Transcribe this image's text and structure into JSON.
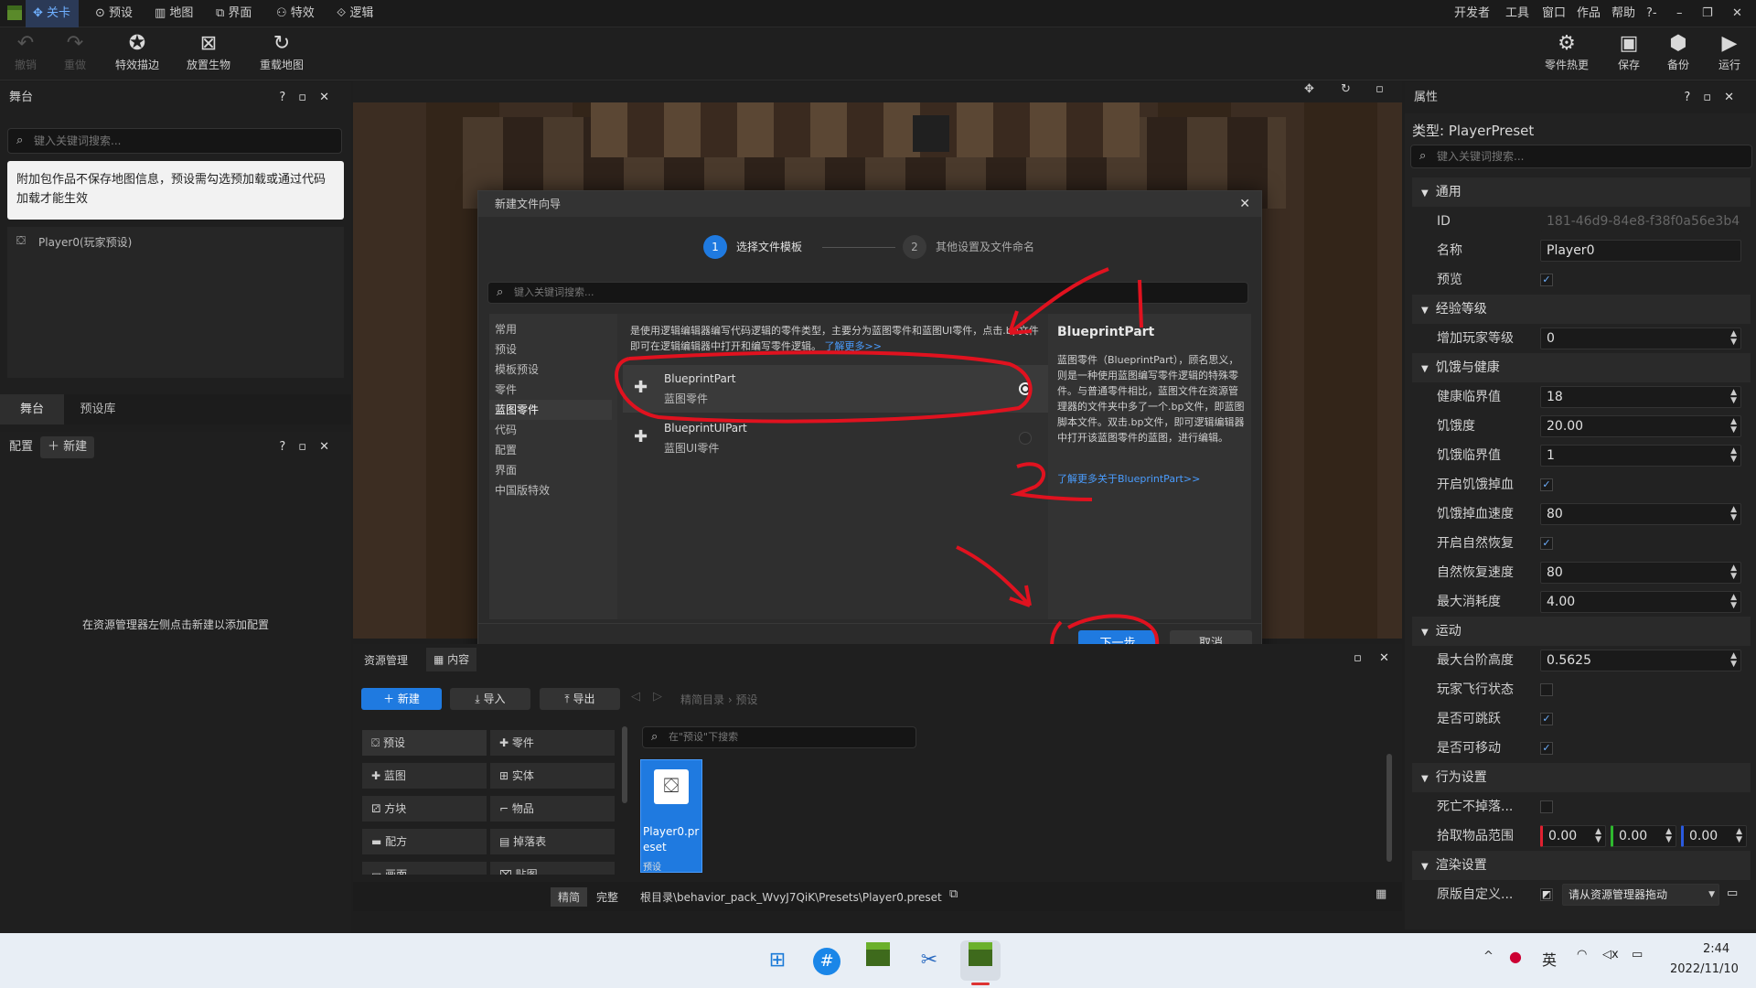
{
  "menubar": {
    "tabs": [
      "关卡",
      "预设",
      "地图",
      "界面",
      "特效",
      "逻辑"
    ],
    "right": [
      "开发者",
      "工具",
      "窗口",
      "作品",
      "帮助",
      "?-",
      "–",
      "❐",
      "✕"
    ]
  },
  "toolbar": {
    "left": [
      {
        "label": "撤销",
        "icon": "undo-icon"
      },
      {
        "label": "重做",
        "icon": "redo-icon"
      },
      {
        "label": "特效描边",
        "icon": "effect-outline-icon"
      },
      {
        "label": "放置生物",
        "icon": "place-creature-icon"
      },
      {
        "label": "重载地图",
        "icon": "reload-map-icon"
      }
    ],
    "right": [
      {
        "label": "零件热更",
        "icon": "part-hotupdate-icon"
      },
      {
        "label": "保存",
        "icon": "save-icon"
      },
      {
        "label": "备份",
        "icon": "backup-icon"
      },
      {
        "label": "运行",
        "icon": "run-icon"
      }
    ]
  },
  "stage_panel": {
    "title": "舞台",
    "search_placeholder": "键入关键词搜索...",
    "notice": "附加包作品不保存地图信息，预设需勾选预加载或通过代码加载才能生效",
    "tree_item": "Player0(玩家预设)",
    "tabs": [
      "舞台",
      "预设库"
    ]
  },
  "config_panel": {
    "title": "配置",
    "new_label": "新建",
    "empty_hint": "在资源管理器左侧点击新建以添加配置"
  },
  "dialog": {
    "title": "新建文件向导",
    "steps": [
      {
        "num": "1",
        "label": "选择文件模板"
      },
      {
        "num": "2",
        "label": "其他设置及文件命名"
      }
    ],
    "search_placeholder": "键入关键词搜索...",
    "categories": [
      "常用",
      "预设",
      "模板预设",
      "零件",
      "蓝图零件",
      "代码",
      "配置",
      "界面",
      "中国版特效"
    ],
    "selected_category": "蓝图零件",
    "description": "是使用逻辑编辑器编写代码逻辑的零件类型，主要分为蓝图零件和蓝图UI零件，点击.bp文件即可在逻辑编辑器中打开和编写零件逻辑。",
    "learn_more": "了解更多>>",
    "templates": [
      {
        "name": "BlueprintPart",
        "sub": "蓝图零件"
      },
      {
        "name": "BlueprintUIPart",
        "sub": "蓝图UI零件"
      }
    ],
    "detail_title": "BlueprintPart",
    "detail_text": "蓝图零件（BlueprintPart），顾名思义，则是一种使用蓝图编写零件逻辑的特殊零件。与普通零件相比，蓝图文件在资源管理器的文件夹中多了一个.bp文件，即蓝图脚本文件。双击.bp文件，即可逻辑编辑器中打开该蓝图零件的蓝图，进行编辑。",
    "detail_link": "了解更多关于BlueprintPart>>",
    "next_label": "下一步",
    "cancel_label": "取消"
  },
  "resource_panel": {
    "title": "资源管理",
    "content_tab": "内容",
    "new_label": "新建",
    "import_label": "导入",
    "export_label": "导出",
    "breadcrumb": [
      "精简目录",
      "预设"
    ],
    "search_placeholder": "在\"预设\"下搜索",
    "left_items": [
      "预设",
      "蓝图",
      "方块",
      "配方",
      "画面"
    ],
    "right_items": [
      "零件",
      "实体",
      "物品",
      "掉落表",
      "贴图"
    ],
    "file_name": "Player0.preset",
    "file_type": "预设",
    "view_modes": [
      "精简",
      "完整"
    ],
    "path": "根目录\\behavior_pack_WvyJ7QiK\\Presets\\Player0.preset"
  },
  "properties": {
    "title": "属性",
    "type_label": "类型: PlayerPreset",
    "search_placeholder": "键入关键词搜索...",
    "sections": [
      {
        "name": "通用",
        "rows": [
          {
            "label": "ID",
            "kind": "text",
            "value": "181-46d9-84e8-f38f0a56e3b4",
            "dim": true
          },
          {
            "label": "名称",
            "kind": "text",
            "value": "Player0"
          },
          {
            "label": "预览",
            "kind": "check",
            "checked": true
          }
        ]
      },
      {
        "name": "经验等级",
        "rows": [
          {
            "label": "增加玩家等级",
            "kind": "num",
            "value": "0"
          }
        ]
      },
      {
        "name": "饥饿与健康",
        "rows": [
          {
            "label": "健康临界值",
            "kind": "num",
            "value": "18"
          },
          {
            "label": "饥饿度",
            "kind": "num",
            "value": "20.00"
          },
          {
            "label": "饥饿临界值",
            "kind": "num",
            "value": "1"
          },
          {
            "label": "开启饥饿掉血",
            "kind": "check",
            "checked": true
          },
          {
            "label": "饥饿掉血速度",
            "kind": "num",
            "value": "80"
          },
          {
            "label": "开启自然恢复",
            "kind": "check",
            "checked": true
          },
          {
            "label": "自然恢复速度",
            "kind": "num",
            "value": "80"
          },
          {
            "label": "最大消耗度",
            "kind": "num",
            "value": "4.00"
          }
        ]
      },
      {
        "name": "运动",
        "rows": [
          {
            "label": "最大台阶高度",
            "kind": "num",
            "value": "0.5625"
          },
          {
            "label": "玩家飞行状态",
            "kind": "check",
            "checked": false
          },
          {
            "label": "是否可跳跃",
            "kind": "check",
            "checked": true
          },
          {
            "label": "是否可移动",
            "kind": "check",
            "checked": true
          }
        ]
      },
      {
        "name": "行为设置",
        "rows": [
          {
            "label": "死亡不掉落...",
            "kind": "check",
            "checked": false
          },
          {
            "label": "拾取物品范围",
            "kind": "xyz",
            "values": [
              "0.00",
              "0.00",
              "0.00"
            ]
          }
        ]
      },
      {
        "name": "渲染设置",
        "rows": [
          {
            "label": "原版自定义...",
            "kind": "dropdown",
            "value": "请从资源管理器拖动"
          }
        ]
      }
    ]
  },
  "taskbar": {
    "ime": "英",
    "time": "2:44",
    "date": "2022/11/10"
  },
  "colors": {
    "accent": "#1f7ae0",
    "annotation": "#e0121f",
    "panel": "#252526"
  }
}
